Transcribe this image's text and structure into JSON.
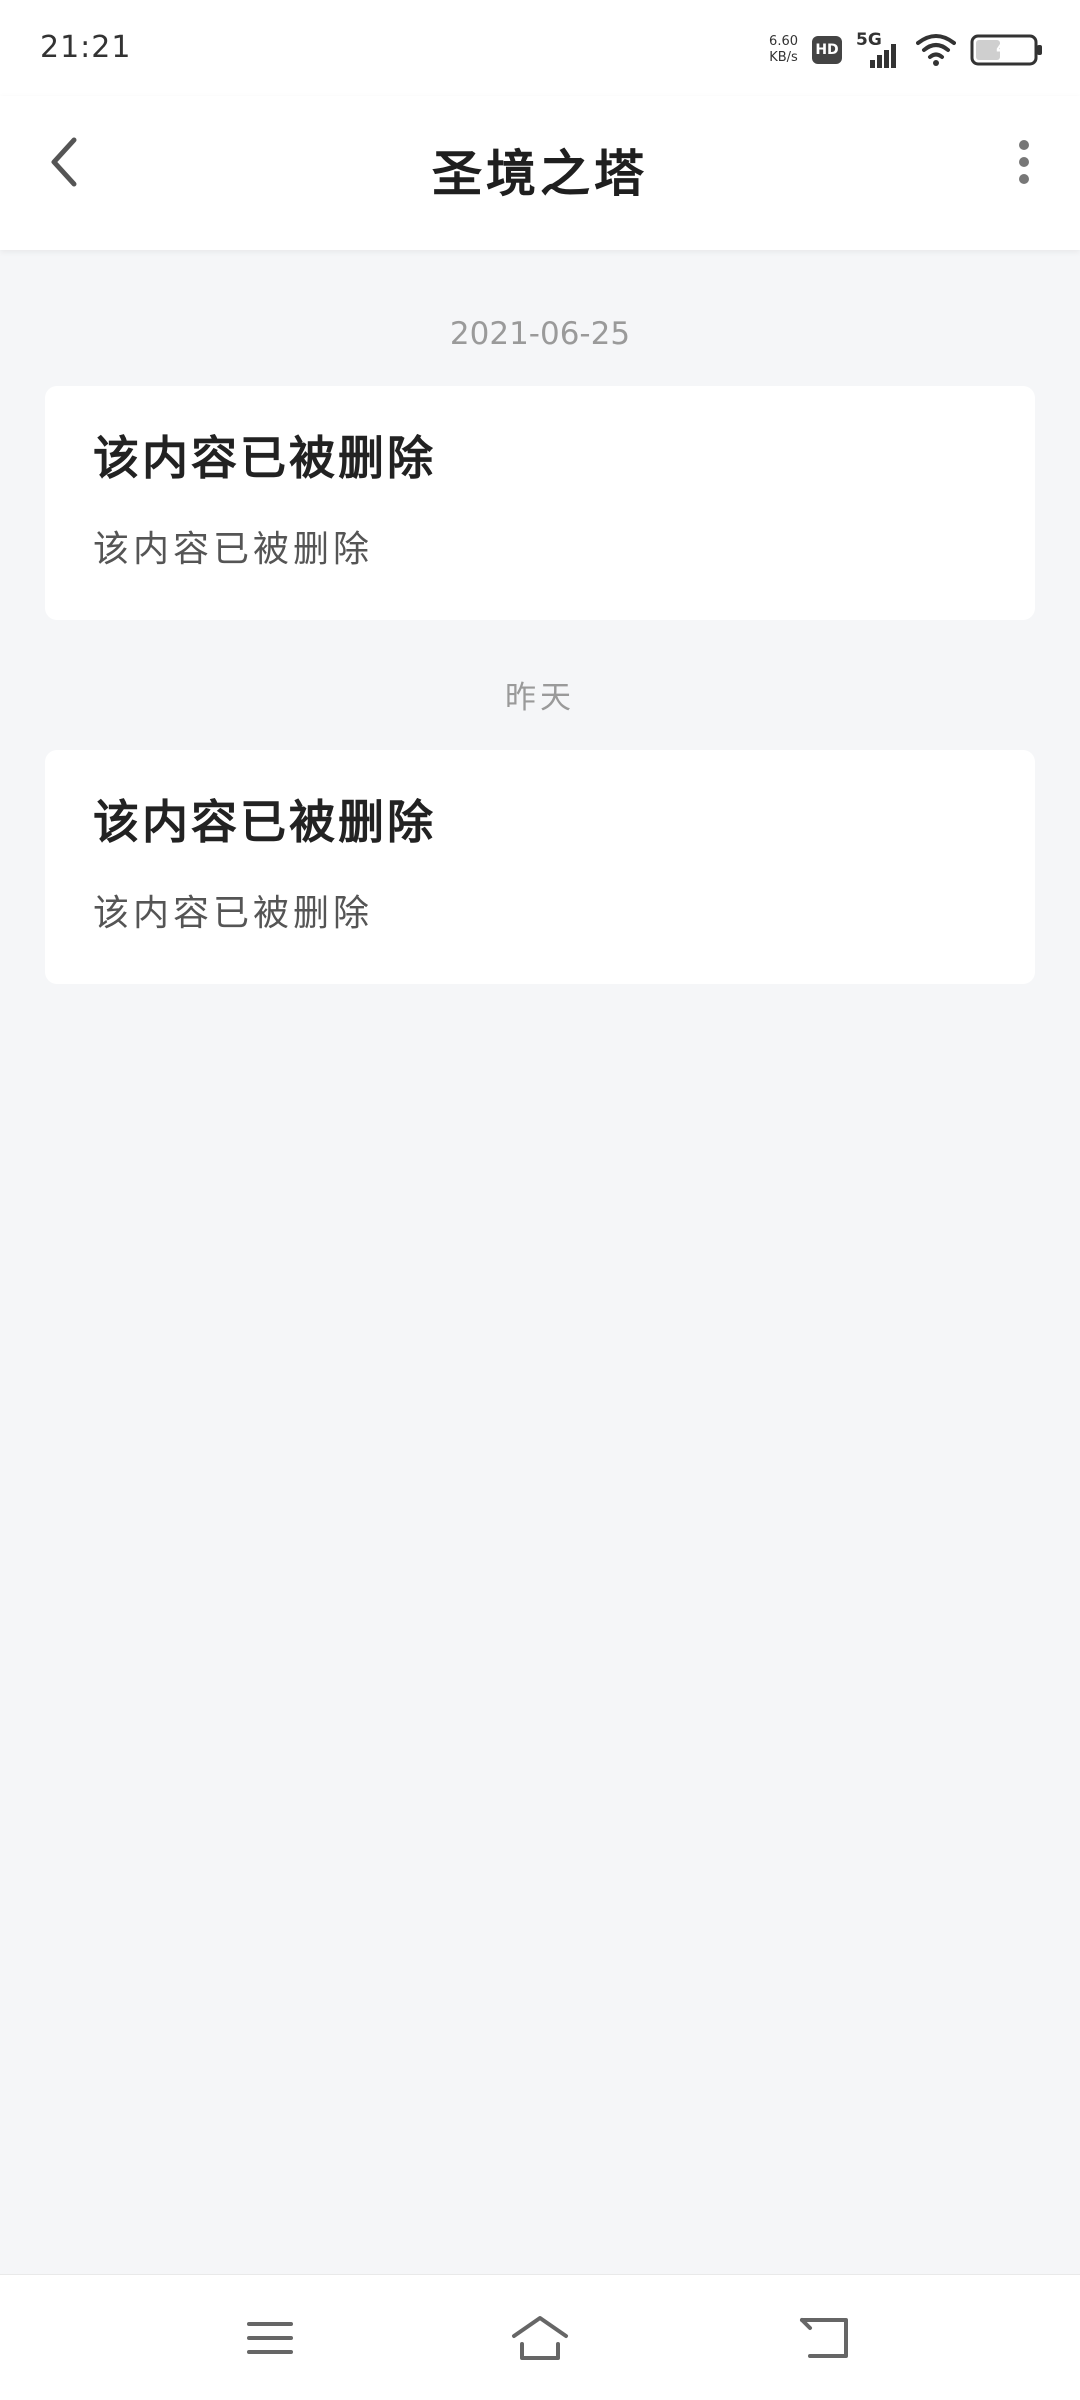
{
  "status_bar": {
    "time": "21:21",
    "net_speed_value": "6.60",
    "net_speed_unit": "KB/s",
    "hd_label": "HD",
    "network_type": "5G",
    "battery_level": "4"
  },
  "header": {
    "title": "圣境之塔",
    "back_icon": "chevron-left-icon",
    "more_icon": "more-vertical-icon"
  },
  "messages": [
    {
      "date": "2021-06-25",
      "title": "该内容已被删除",
      "body": "该内容已被删除"
    },
    {
      "date": "昨天",
      "title": "该内容已被删除",
      "body": "该内容已被删除"
    }
  ],
  "nav_bar": {
    "menu_icon": "menu-icon",
    "home_icon": "home-icon",
    "back_icon": "back-icon"
  },
  "colors": {
    "background": "#f5f6f8",
    "card": "#ffffff",
    "title_text": "#1f1f1f",
    "muted_text": "#9a9a9a",
    "icon": "#666666"
  }
}
